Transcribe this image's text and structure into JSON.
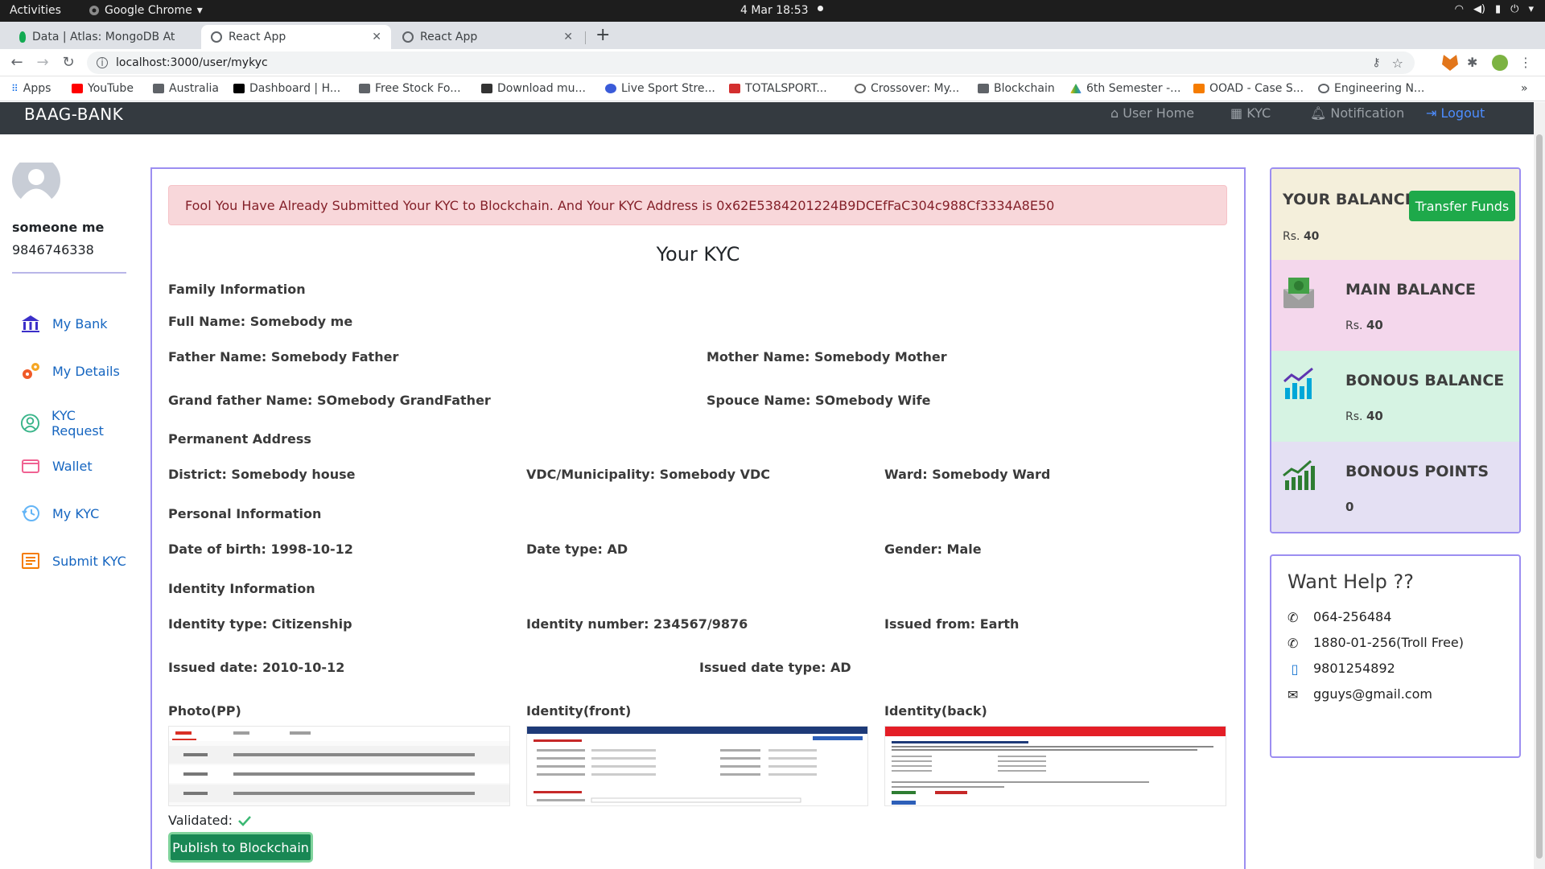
{
  "system_bar": {
    "activities": "Activities",
    "app": "Google Chrome",
    "clock": "4 Mar  18:53"
  },
  "tabs": [
    {
      "title": "Data | Atlas: MongoDB At",
      "active": false
    },
    {
      "title": "React App",
      "active": true
    },
    {
      "title": "React App",
      "active": false
    }
  ],
  "address_bar": {
    "url": "localhost:3000/user/mykyc"
  },
  "bookmarks": [
    {
      "label": "Apps",
      "icon": "apps-grid-icon"
    },
    {
      "label": "YouTube",
      "icon": "youtube-icon"
    },
    {
      "label": "Australia",
      "icon": "folder-icon"
    },
    {
      "label": "Dashboard | H...",
      "icon": "dashboard-icon"
    },
    {
      "label": "Free Stock Fo...",
      "icon": "folder-icon"
    },
    {
      "label": "Download mu...",
      "icon": "download-icon"
    },
    {
      "label": "Live Sport Stre...",
      "icon": "sport-icon"
    },
    {
      "label": "TOTALSPORT...",
      "icon": "ts-icon"
    },
    {
      "label": "Crossover: My...",
      "icon": "crossover-icon"
    },
    {
      "label": "Blockchain",
      "icon": "folder-icon"
    },
    {
      "label": "6th Semester -...",
      "icon": "drive-icon"
    },
    {
      "label": "OOAD - Case S...",
      "icon": "blogger-icon"
    },
    {
      "label": "Engineering N...",
      "icon": "globe-icon"
    }
  ],
  "app_nav": {
    "brand": "BAAG-BANK",
    "links": {
      "home": "User Home",
      "kyc": "KYC",
      "notification": "Notification",
      "logout": "Logout"
    }
  },
  "sidebar": {
    "name": "someone me",
    "phone": "9846746338",
    "items": [
      {
        "label": "My Bank",
        "icon": "bank-icon"
      },
      {
        "label": "My Details",
        "icon": "gears-icon"
      },
      {
        "label": "KYC Request",
        "icon": "user-circle-icon"
      },
      {
        "label": "Wallet",
        "icon": "wallet-icon"
      },
      {
        "label": "My KYC",
        "icon": "history-icon"
      },
      {
        "label": "Submit KYC",
        "icon": "form-icon"
      }
    ]
  },
  "kyc": {
    "alert": "Fool You Have Already Submitted Your KYC to Blockchain. And Your KYC Address is 0x62E5384201224B9DCEfFaC304c988Cf3334A8E50",
    "title": "Your KYC",
    "sections": {
      "family": "Family Information",
      "address": "Permanent Address",
      "personal": "Personal Information",
      "identity": "Identity Information"
    },
    "fields": {
      "full_name": "Full Name: Somebody me",
      "father": "Father Name: Somebody Father",
      "mother": "Mother Name: Somebody Mother",
      "grandfather": "Grand father Name: SOmebody GrandFather",
      "spouse": "Spouce Name: SOmebody Wife",
      "district": "District: Somebody house",
      "vdc": "VDC/Municipality: Somebody VDC",
      "ward": "Ward: Somebody Ward",
      "dob": "Date of birth: 1998-10-12",
      "date_type": "Date type: AD",
      "gender": "Gender: Male",
      "id_type": "Identity type: Citizenship",
      "id_number": "Identity number: 234567/9876",
      "issued_from": "Issued from: Earth",
      "issued_date": "Issued date: 2010-10-12",
      "issued_date_type": "Issued date type: AD"
    },
    "images": {
      "photo": "Photo(PP)",
      "front": "Identity(front)",
      "back": "Identity(back)"
    },
    "validated": "Validated:",
    "publish": "Publish to Blockchain"
  },
  "balances": {
    "your_balance": {
      "title": "YOUR BALANCE",
      "prefix": "Rs.",
      "value": "40"
    },
    "transfer": "Transfer Funds",
    "main": {
      "title": "MAIN BALANCE",
      "prefix": "Rs.",
      "value": "40"
    },
    "bonus": {
      "title": "BONOUS BALANCE",
      "prefix": "Rs.",
      "value": "40"
    },
    "points": {
      "title": "BONOUS POINTS",
      "value": "0"
    }
  },
  "help": {
    "title": "Want Help ??",
    "phone1": "064-256484",
    "phone2": "1880-01-256(Troll Free)",
    "mobile": "9801254892",
    "email": "gguys@gmail.com"
  },
  "colors": {
    "accent_border": "#9c8ef1",
    "navbar": "#343a40",
    "alert_bg": "#f8d7da",
    "success": "#198754",
    "balance_bg": "#f4efdb",
    "main_bg": "#f4d7ec",
    "bonus_bg": "#d6f3e3",
    "points_bg": "#e4e0f3"
  }
}
